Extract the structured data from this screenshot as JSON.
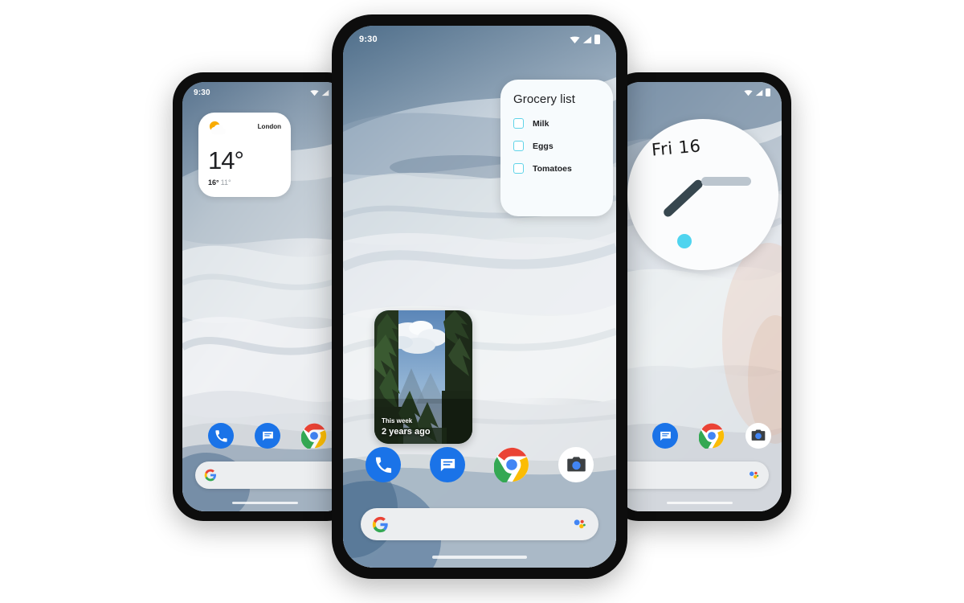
{
  "scene": {
    "description": "Three Android Pixel phones showing home screens with widgets",
    "background_color": "#ffffff"
  },
  "phones": {
    "left": {
      "name": "left-phone",
      "status_bar": {
        "time": "9:30",
        "icons": [
          "wifi-icon",
          "signal-icon",
          "battery-icon"
        ]
      },
      "weather_widget": {
        "city": "London",
        "temperature": "14°",
        "high": "16°",
        "low": "11°",
        "icon": "sun-cloud-icon"
      },
      "dock_apps": [
        {
          "name": "phone-app",
          "label": "Phone"
        },
        {
          "name": "messages-app",
          "label": "Messages"
        },
        {
          "name": "chrome-app",
          "label": "Chrome"
        }
      ],
      "search": {
        "logo": "google-g-icon",
        "placeholder": ""
      }
    },
    "center": {
      "name": "center-phone",
      "status_bar": {
        "time": "9:30",
        "icons": [
          "wifi-icon",
          "signal-icon",
          "battery-icon"
        ]
      },
      "grocery_widget": {
        "title": "Grocery list",
        "items": [
          {
            "label": "Milk",
            "checked": false
          },
          {
            "label": "Eggs",
            "checked": false
          },
          {
            "label": "Tomatoes",
            "checked": false
          }
        ]
      },
      "photo_widget": {
        "caption_top": "This week",
        "caption_main": "2 years ago",
        "scene": "forest-landscape"
      },
      "dock_apps": [
        {
          "name": "phone-app",
          "label": "Phone"
        },
        {
          "name": "messages-app",
          "label": "Messages"
        },
        {
          "name": "chrome-app",
          "label": "Chrome"
        },
        {
          "name": "camera-app",
          "label": "Camera"
        }
      ],
      "search": {
        "logo": "google-g-icon",
        "assistant": "assistant-icon",
        "placeholder": ""
      }
    },
    "right": {
      "name": "right-phone",
      "status_bar": {
        "icons": [
          "wifi-icon",
          "signal-icon",
          "battery-icon"
        ]
      },
      "clock_widget": {
        "date": "Fri 16",
        "hour_hand": "dark",
        "minute_hand": "light"
      },
      "dock_apps": [
        {
          "name": "messages-app",
          "label": "Messages"
        },
        {
          "name": "chrome-app",
          "label": "Chrome"
        },
        {
          "name": "camera-app",
          "label": "Camera"
        }
      ],
      "search": {
        "assistant": "assistant-icon",
        "placeholder": ""
      }
    }
  },
  "colors": {
    "phone_frame": "#0d0d0d",
    "widget_white": "#ffffff",
    "checkbox_accent": "#5fd3e8",
    "clock_dot": "#4fd4ef",
    "clock_hand_dark": "#37474f",
    "clock_hand_light": "#bbc5ce",
    "google_blue": "#1a73e8",
    "google_red": "#ea4335",
    "google_yellow": "#fbbc04",
    "google_green": "#34a853"
  }
}
